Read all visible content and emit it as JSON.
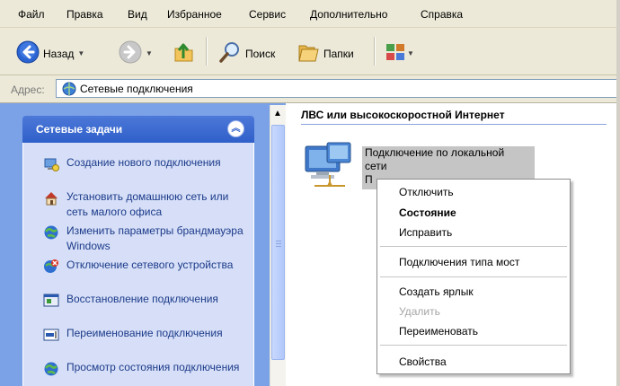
{
  "menu": [
    "Файл",
    "Правка",
    "Вид",
    "Избранное",
    "Сервис",
    "Дополнительно",
    "Справка"
  ],
  "toolbar": {
    "back_label": "Назад",
    "search_label": "Поиск",
    "folders_label": "Папки"
  },
  "address": {
    "label": "Адрес:",
    "value": "Сетевые подключения"
  },
  "tasks": {
    "title": "Сетевые задачи",
    "items": [
      {
        "label": "Создание нового подключения",
        "icon": "new-connection-icon"
      },
      {
        "label": "Установить домашнюю сеть или сеть малого офиса",
        "icon": "home-network-icon"
      },
      {
        "label": "Изменить параметры брандмауэра Windows",
        "icon": "firewall-icon"
      },
      {
        "label": "Отключение сетевого устройства",
        "icon": "disable-device-icon"
      },
      {
        "label": "Восстановление подключения",
        "icon": "repair-icon"
      },
      {
        "label": "Переименование подключения",
        "icon": "rename-icon"
      },
      {
        "label": "Просмотр состояния подключения",
        "icon": "status-icon"
      }
    ]
  },
  "content": {
    "group_header": "ЛВС или высокоскоростной Интернет",
    "connection": {
      "line1": "Подключение по локальной",
      "line2": "сети",
      "line3": "П"
    }
  },
  "context_menu": {
    "items": [
      {
        "label": "Отключить",
        "style": "normal"
      },
      {
        "label": "Состояние",
        "style": "bold"
      },
      {
        "label": "Исправить",
        "style": "normal"
      },
      {
        "label": "Подключения типа мост",
        "style": "normal"
      },
      {
        "label": "Создать ярлык",
        "style": "normal"
      },
      {
        "label": "Удалить",
        "style": "disabled"
      },
      {
        "label": "Переименовать",
        "style": "normal"
      },
      {
        "label": "Свойства",
        "style": "normal"
      }
    ]
  },
  "colors": {
    "chrome": "#ece9d8",
    "task_pane": "#7ba2e7",
    "task_header": "#2f5fc9",
    "task_body": "#d6dff7",
    "selection": "#c5c5c5"
  }
}
